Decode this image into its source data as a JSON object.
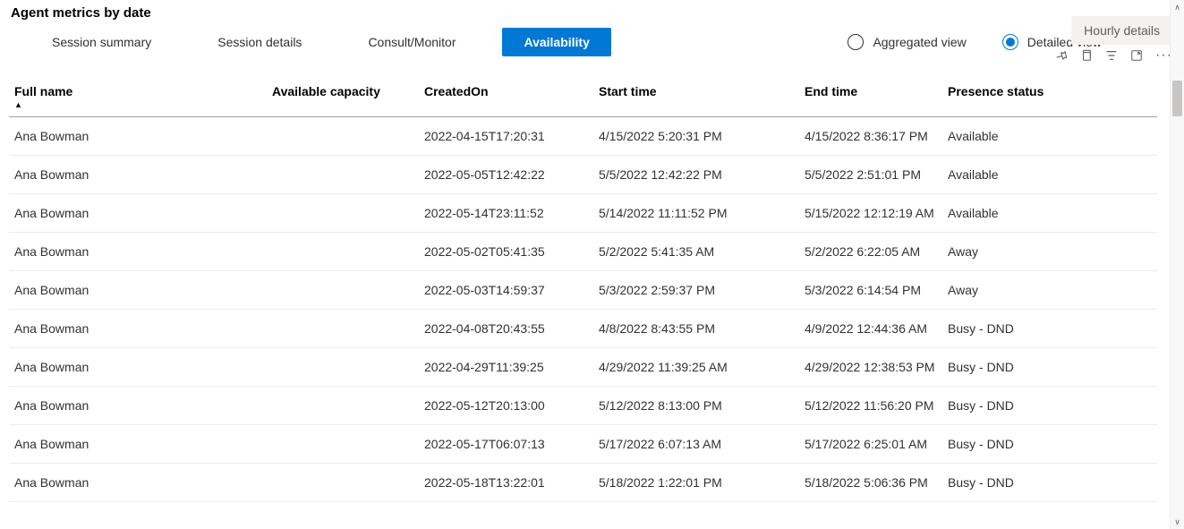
{
  "title": "Agent metrics by date",
  "tabs": [
    {
      "label": "Session summary",
      "active": false
    },
    {
      "label": "Session details",
      "active": false
    },
    {
      "label": "Consult/Monitor",
      "active": false
    },
    {
      "label": "Availability",
      "active": true
    }
  ],
  "viewOptions": {
    "aggregated": {
      "label": "Aggregated view",
      "selected": false
    },
    "detailed": {
      "label": "Detailed view",
      "selected": true
    }
  },
  "hourlyButton": "Hourly details",
  "columns": {
    "full_name": "Full name",
    "available_capacity": "Available capacity",
    "created_on": "CreatedOn",
    "start_time": "Start time",
    "end_time": "End time",
    "presence_status": "Presence status"
  },
  "sortColumn": "full_name",
  "rows": [
    {
      "full_name": "Ana Bowman",
      "available_capacity": "",
      "created_on": "2022-04-15T17:20:31",
      "start_time": "4/15/2022 5:20:31 PM",
      "end_time": "4/15/2022 8:36:17 PM",
      "presence_status": "Available"
    },
    {
      "full_name": "Ana Bowman",
      "available_capacity": "",
      "created_on": "2022-05-05T12:42:22",
      "start_time": "5/5/2022 12:42:22 PM",
      "end_time": "5/5/2022 2:51:01 PM",
      "presence_status": "Available"
    },
    {
      "full_name": "Ana Bowman",
      "available_capacity": "",
      "created_on": "2022-05-14T23:11:52",
      "start_time": "5/14/2022 11:11:52 PM",
      "end_time": "5/15/2022 12:12:19 AM",
      "presence_status": "Available"
    },
    {
      "full_name": "Ana Bowman",
      "available_capacity": "",
      "created_on": "2022-05-02T05:41:35",
      "start_time": "5/2/2022 5:41:35 AM",
      "end_time": "5/2/2022 6:22:05 AM",
      "presence_status": "Away"
    },
    {
      "full_name": "Ana Bowman",
      "available_capacity": "",
      "created_on": "2022-05-03T14:59:37",
      "start_time": "5/3/2022 2:59:37 PM",
      "end_time": "5/3/2022 6:14:54 PM",
      "presence_status": "Away"
    },
    {
      "full_name": "Ana Bowman",
      "available_capacity": "",
      "created_on": "2022-04-08T20:43:55",
      "start_time": "4/8/2022 8:43:55 PM",
      "end_time": "4/9/2022 12:44:36 AM",
      "presence_status": "Busy - DND"
    },
    {
      "full_name": "Ana Bowman",
      "available_capacity": "",
      "created_on": "2022-04-29T11:39:25",
      "start_time": "4/29/2022 11:39:25 AM",
      "end_time": "4/29/2022 12:38:53 PM",
      "presence_status": "Busy - DND"
    },
    {
      "full_name": "Ana Bowman",
      "available_capacity": "",
      "created_on": "2022-05-12T20:13:00",
      "start_time": "5/12/2022 8:13:00 PM",
      "end_time": "5/12/2022 11:56:20 PM",
      "presence_status": "Busy - DND"
    },
    {
      "full_name": "Ana Bowman",
      "available_capacity": "",
      "created_on": "2022-05-17T06:07:13",
      "start_time": "5/17/2022 6:07:13 AM",
      "end_time": "5/17/2022 6:25:01 AM",
      "presence_status": "Busy - DND"
    },
    {
      "full_name": "Ana Bowman",
      "available_capacity": "",
      "created_on": "2022-05-18T13:22:01",
      "start_time": "5/18/2022 1:22:01 PM",
      "end_time": "5/18/2022 5:06:36 PM",
      "presence_status": "Busy - DND"
    }
  ]
}
